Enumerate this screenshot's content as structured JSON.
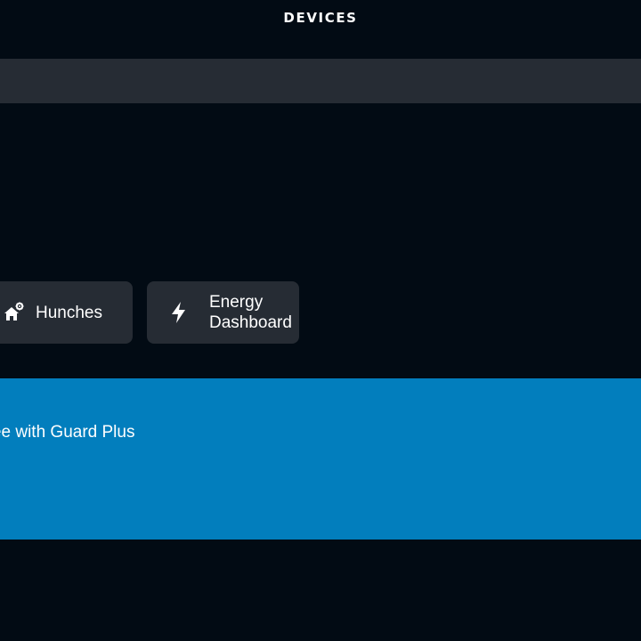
{
  "header": {
    "title": "DEVICES"
  },
  "search": {
    "value": ""
  },
  "shortcuts": [
    {
      "label": "Hunches",
      "icon": "home-gear-icon"
    },
    {
      "label": "Energy\nDashboard",
      "icon": "lightning-bolt-icon"
    }
  ],
  "banner": {
    "text": "Hands-free with Guard Plus",
    "visible_text": "-free with Guard Plus",
    "background": "#027ebd"
  },
  "colors": {
    "background": "#020b14",
    "surface": "#262c34",
    "accent": "#027ebd",
    "text": "#ffffff"
  }
}
